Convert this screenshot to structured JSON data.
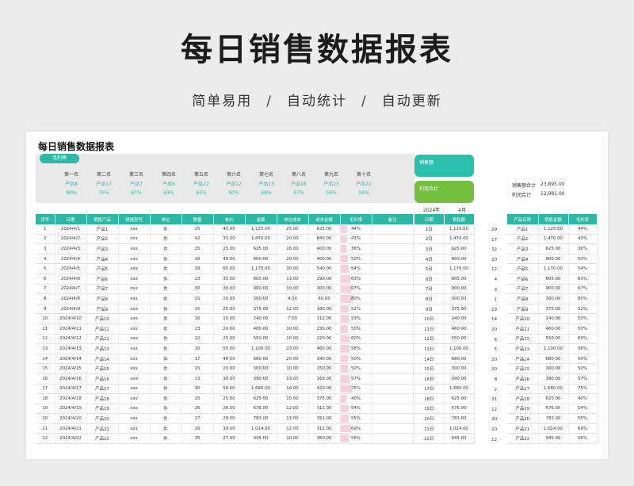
{
  "hero": {
    "title": "每日销售数据报表",
    "sub1": "简单易用",
    "sub2": "自动统计",
    "sub3": "自动更新",
    "sep": "/"
  },
  "sheet_title": "每日销售数据报表",
  "summary": {
    "tab_label": "毛利榜",
    "ranks": [
      {
        "rank": "第一名",
        "product": "产品8",
        "margin": "80%"
      },
      {
        "rank": "第二名",
        "product": "产品17",
        "margin": "75%"
      },
      {
        "rank": "第三名",
        "product": "产品7",
        "margin": "67%"
      },
      {
        "rank": "第四名",
        "product": "产品6",
        "margin": "63%"
      },
      {
        "rank": "第五名",
        "product": "产品22",
        "margin": "62%"
      },
      {
        "rank": "第六名",
        "product": "产品12",
        "margin": "60%"
      },
      {
        "rank": "第七名",
        "product": "产品13",
        "margin": "58%"
      },
      {
        "rank": "第八名",
        "product": "产品16",
        "margin": "57%"
      },
      {
        "rank": "第九名",
        "product": "产品23",
        "margin": "56%"
      },
      {
        "rank": "第十名",
        "product": "产品22",
        "margin": "56%"
      }
    ]
  },
  "kpi": {
    "sales_label": "销售额",
    "profit_label": "利润合计",
    "sales_total_label": "销售额合计",
    "sales_total_value": "23,895.00",
    "profit_total_label": "利润合计",
    "profit_total_value": "12,981.00",
    "year": "2024年",
    "month": "4月"
  },
  "main_table": {
    "headers": [
      "序号",
      "日期",
      "销售产品",
      "规格型号",
      "单位",
      "数量",
      "单价",
      "金额",
      "单位成本",
      "成本金额",
      "毛利率",
      "备注"
    ],
    "rows": [
      [
        "1",
        "2024/4/1",
        "产品1",
        "xxx",
        "件",
        "25",
        "45.00",
        "1,125.00",
        "25.00",
        "625.00",
        "44%",
        ""
      ],
      [
        "2",
        "2024/4/2",
        "产品2",
        "xxx",
        "件",
        "42",
        "35.00",
        "1,470.00",
        "20.00",
        "840.00",
        "43%",
        ""
      ],
      [
        "3",
        "2024/4/3",
        "产品3",
        "xxx",
        "件",
        "25",
        "25.00",
        "625.00",
        "16.00",
        "400.00",
        "36%",
        ""
      ],
      [
        "4",
        "2024/4/4",
        "产品4",
        "xxx",
        "件",
        "20",
        "40.00",
        "800.00",
        "20.00",
        "400.00",
        "50%",
        ""
      ],
      [
        "5",
        "2024/4/5",
        "产品5",
        "xxx",
        "件",
        "18",
        "65.00",
        "1,170.00",
        "30.00",
        "540.00",
        "54%",
        ""
      ],
      [
        "6",
        "2024/4/6",
        "产品6",
        "xxx",
        "件",
        "23",
        "35.00",
        "805.00",
        "13.00",
        "299.00",
        "63%",
        ""
      ],
      [
        "7",
        "2024/4/7",
        "产品7",
        "xxx",
        "件",
        "30",
        "30.00",
        "900.00",
        "10.00",
        "300.00",
        "67%",
        ""
      ],
      [
        "8",
        "2024/4/8",
        "产品8",
        "xxx",
        "件",
        "15",
        "20.00",
        "300.00",
        "4.00",
        "60.00",
        "80%",
        ""
      ],
      [
        "9",
        "2024/4/9",
        "产品9",
        "xxx",
        "件",
        "15",
        "25.00",
        "375.00",
        "12.00",
        "180.00",
        "52%",
        ""
      ],
      [
        "10",
        "2024/4/10",
        "产品10",
        "xxx",
        "件",
        "16",
        "15.00",
        "240.00",
        "7.00",
        "112.00",
        "53%",
        ""
      ],
      [
        "11",
        "2024/4/11",
        "产品11",
        "xxx",
        "件",
        "23",
        "20.00",
        "460.00",
        "10.00",
        "230.00",
        "50%",
        ""
      ],
      [
        "12",
        "2024/4/12",
        "产品12",
        "xxx",
        "件",
        "22",
        "25.00",
        "550.00",
        "10.00",
        "220.00",
        "60%",
        ""
      ],
      [
        "13",
        "2024/4/13",
        "产品13",
        "xxx",
        "件",
        "20",
        "55.00",
        "1,100.00",
        "23.00",
        "460.00",
        "58%",
        ""
      ],
      [
        "14",
        "2024/4/14",
        "产品14",
        "xxx",
        "件",
        "17",
        "40.00",
        "680.00",
        "20.00",
        "340.00",
        "50%",
        ""
      ],
      [
        "15",
        "2024/4/15",
        "产品15",
        "xxx",
        "件",
        "15",
        "20.00",
        "300.00",
        "10.00",
        "150.00",
        "50%",
        ""
      ],
      [
        "16",
        "2024/4/16",
        "产品16",
        "xxx",
        "件",
        "13",
        "30.00",
        "390.00",
        "13.00",
        "169.00",
        "57%",
        ""
      ],
      [
        "17",
        "2024/4/17",
        "产品17",
        "xxx",
        "件",
        "30",
        "56.00",
        "1,680.00",
        "14.00",
        "420.00",
        "75%",
        ""
      ],
      [
        "18",
        "2024/4/18",
        "产品18",
        "xxx",
        "件",
        "25",
        "25.00",
        "625.00",
        "15.00",
        "375.00",
        "40%",
        ""
      ],
      [
        "19",
        "2024/4/19",
        "产品19",
        "xxx",
        "件",
        "26",
        "26.00",
        "676.00",
        "12.00",
        "312.00",
        "54%",
        ""
      ],
      [
        "20",
        "2024/4/20",
        "产品20",
        "xxx",
        "件",
        "27",
        "29.00",
        "783.00",
        "13.00",
        "351.00",
        "55%",
        ""
      ],
      [
        "21",
        "2024/4/21",
        "产品21",
        "xxx",
        "件",
        "26",
        "39.00",
        "1,014.00",
        "12.00",
        "312.00",
        "69%",
        ""
      ],
      [
        "22",
        "2024/4/22",
        "产品22",
        "xxx",
        "件",
        "35",
        "27.00",
        "945.00",
        "10.00",
        "360.00",
        "56%",
        ""
      ]
    ]
  },
  "day_table": {
    "headers": [
      "日期",
      "销售额"
    ],
    "rows": [
      [
        "1日",
        "1,125.00"
      ],
      [
        "2日",
        "1,470.00"
      ],
      [
        "3日",
        "625.00"
      ],
      [
        "4日",
        "800.00"
      ],
      [
        "5日",
        "1,170.00"
      ],
      [
        "6日",
        "805.00"
      ],
      [
        "7日",
        "900.00"
      ],
      [
        "8日",
        "300.00"
      ],
      [
        "9日",
        "375.00"
      ],
      [
        "10日",
        "240.00"
      ],
      [
        "11日",
        "460.00"
      ],
      [
        "12日",
        "550.00"
      ],
      [
        "13日",
        "1,100.00"
      ],
      [
        "14日",
        "680.00"
      ],
      [
        "15日",
        "300.00"
      ],
      [
        "16日",
        "390.00"
      ],
      [
        "17日",
        "1,680.00"
      ],
      [
        "18日",
        "625.00"
      ],
      [
        "19日",
        "676.00"
      ],
      [
        "20日",
        "783.00"
      ],
      [
        "21日",
        "1,014.00"
      ],
      [
        "22日",
        "945.00"
      ]
    ]
  },
  "rank_numbers": [
    "29",
    "17",
    "32",
    "20",
    "12",
    "4",
    "3",
    "1",
    "19",
    "14",
    "20",
    "6",
    "5",
    "20",
    "20",
    "8",
    "2",
    "31",
    "12",
    "20",
    "10",
    "12"
  ],
  "product_table": {
    "headers": [
      "产品名称",
      "销售金额",
      "毛利率"
    ],
    "rows": [
      [
        "产品1",
        "1,125.00",
        "44%"
      ],
      [
        "产品2",
        "1,470.00",
        "43%"
      ],
      [
        "产品3",
        "625.00",
        "36%"
      ],
      [
        "产品4",
        "800.00",
        "50%"
      ],
      [
        "产品5",
        "1,170.00",
        "54%"
      ],
      [
        "产品6",
        "805.00",
        "63%"
      ],
      [
        "产品7",
        "900.00",
        "67%"
      ],
      [
        "产品8",
        "300.00",
        "80%"
      ],
      [
        "产品9",
        "375.00",
        "52%"
      ],
      [
        "产品10",
        "240.00",
        "53%"
      ],
      [
        "产品11",
        "460.00",
        "50%"
      ],
      [
        "产品12",
        "550.00",
        "60%"
      ],
      [
        "产品13",
        "1,100.00",
        "58%"
      ],
      [
        "产品14",
        "680.00",
        "50%"
      ],
      [
        "产品15",
        "300.00",
        "50%"
      ],
      [
        "产品16",
        "390.00",
        "57%"
      ],
      [
        "产品17",
        "1,680.00",
        "75%"
      ],
      [
        "产品18",
        "625.00",
        "40%"
      ],
      [
        "产品19",
        "676.00",
        "54%"
      ],
      [
        "产品20",
        "783.00",
        "55%"
      ],
      [
        "产品21",
        "1,014.00",
        "69%"
      ],
      [
        "产品22",
        "945.00",
        "56%"
      ]
    ]
  }
}
